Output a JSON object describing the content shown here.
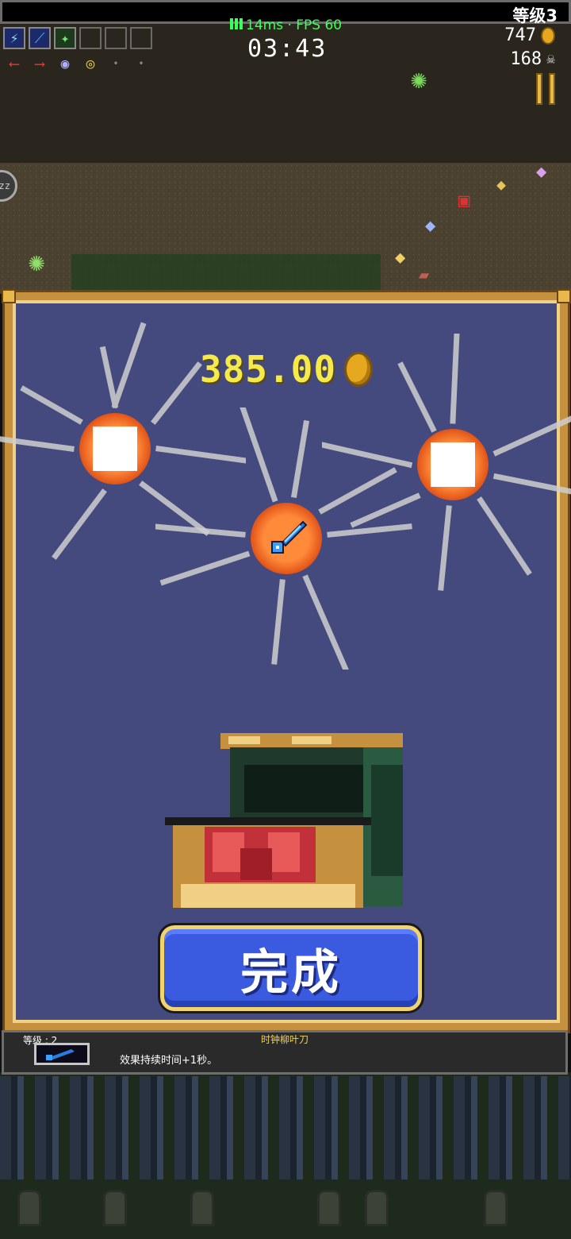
{
  "hud": {
    "level_label": "等级3",
    "ping": "14ms · FPS 60",
    "timer": "03:43",
    "gold": "747",
    "kills": "168",
    "weapon_slots": [
      "lightning-ring-icon",
      "whip-icon",
      "garlic-icon",
      "empty",
      "empty",
      "empty"
    ],
    "passive_slots": [
      "arrow-left-icon",
      "arrow-right-icon",
      "orb-icon",
      "ring-icon",
      "empty",
      "empty"
    ],
    "side_bubble": "zz"
  },
  "chest_dialog": {
    "gold_total": "385.00",
    "rewards": [
      "blank",
      "blank",
      "clock-lancet-icon"
    ],
    "done_button": "完成"
  },
  "item_info": {
    "level": "等级 : 2",
    "name": "时钟柳叶刀",
    "description": "效果持续时间+1秒。"
  },
  "colors": {
    "panel_bg": "#444a7e",
    "panel_border": "#c6913f",
    "gold_text": "#f5ea4a",
    "button_bg": "#3a5ae0",
    "ping_green": "#3cff5a"
  }
}
